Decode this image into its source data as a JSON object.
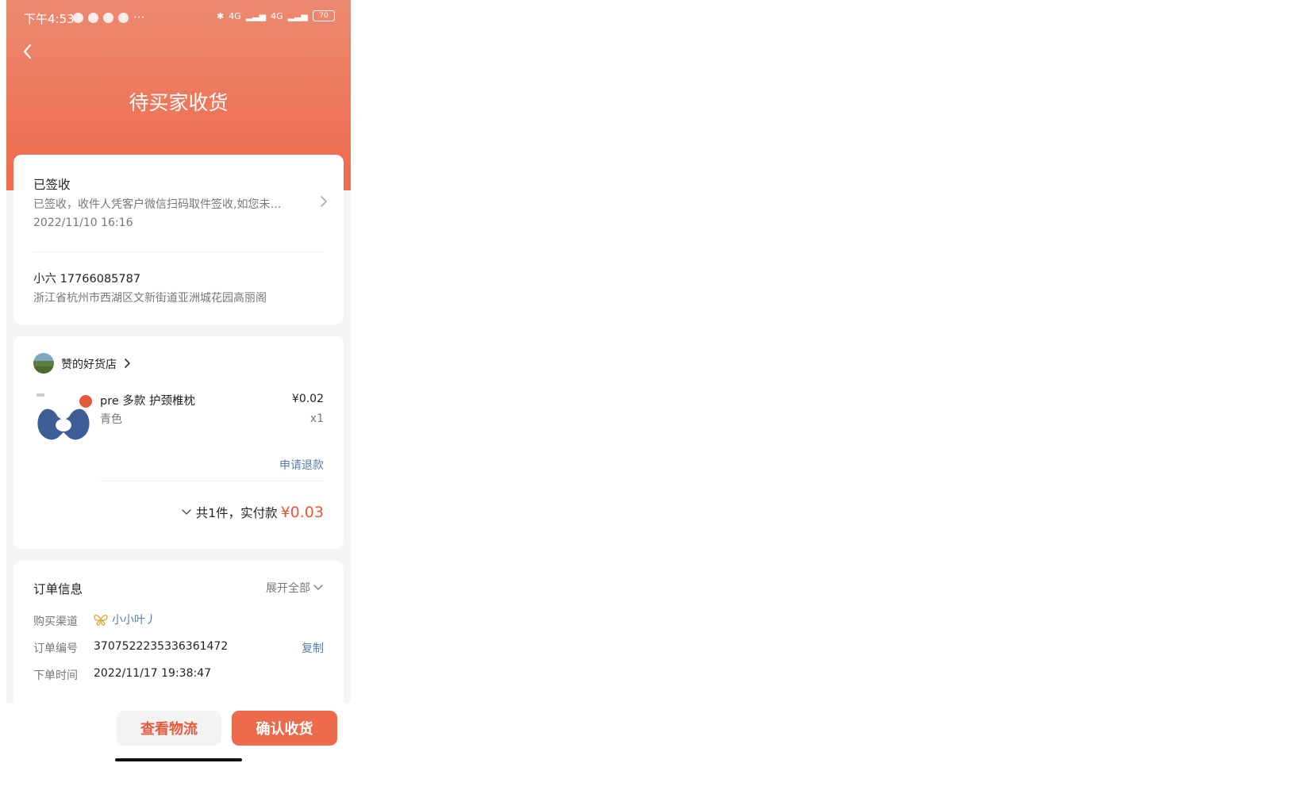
{
  "status_bar": {
    "time": "下午4:53",
    "battery": "70",
    "network": "4G"
  },
  "header": {
    "title": "待买家收货"
  },
  "logistics": {
    "status": "已签收",
    "detail": "已签收，收件人凭客户微信扫码取件签收,如您未…",
    "time": "2022/11/10 16:16"
  },
  "address": {
    "name_phone": "小六 17766085787",
    "address": "浙江省杭州市西湖区文新街道亚洲城花园高丽阁"
  },
  "shop": {
    "name": "赞的好货店"
  },
  "product": {
    "title": "pre 多款 护颈椎枕",
    "spec": "青色",
    "price": "¥0.02",
    "qty": "x1",
    "refund_label": "申请退款"
  },
  "summary": {
    "label": "共1件，实付款",
    "amount": "¥0.03"
  },
  "order_info": {
    "title": "订单信息",
    "expand_label": "展开全部",
    "rows": [
      {
        "label": "购买渠道",
        "value": "小小叶丿"
      },
      {
        "label": "订单编号",
        "value": "3707522235336361472",
        "action": "复制"
      },
      {
        "label": "下单时间",
        "value": "2022/11/17 19:38:47"
      }
    ]
  },
  "bottom_actions": {
    "logistics_label": "查看物流",
    "confirm_label": "确认收货"
  },
  "colors": {
    "accent": "#ee6a4c",
    "price": "#e8583a",
    "link": "#5a7da8"
  }
}
